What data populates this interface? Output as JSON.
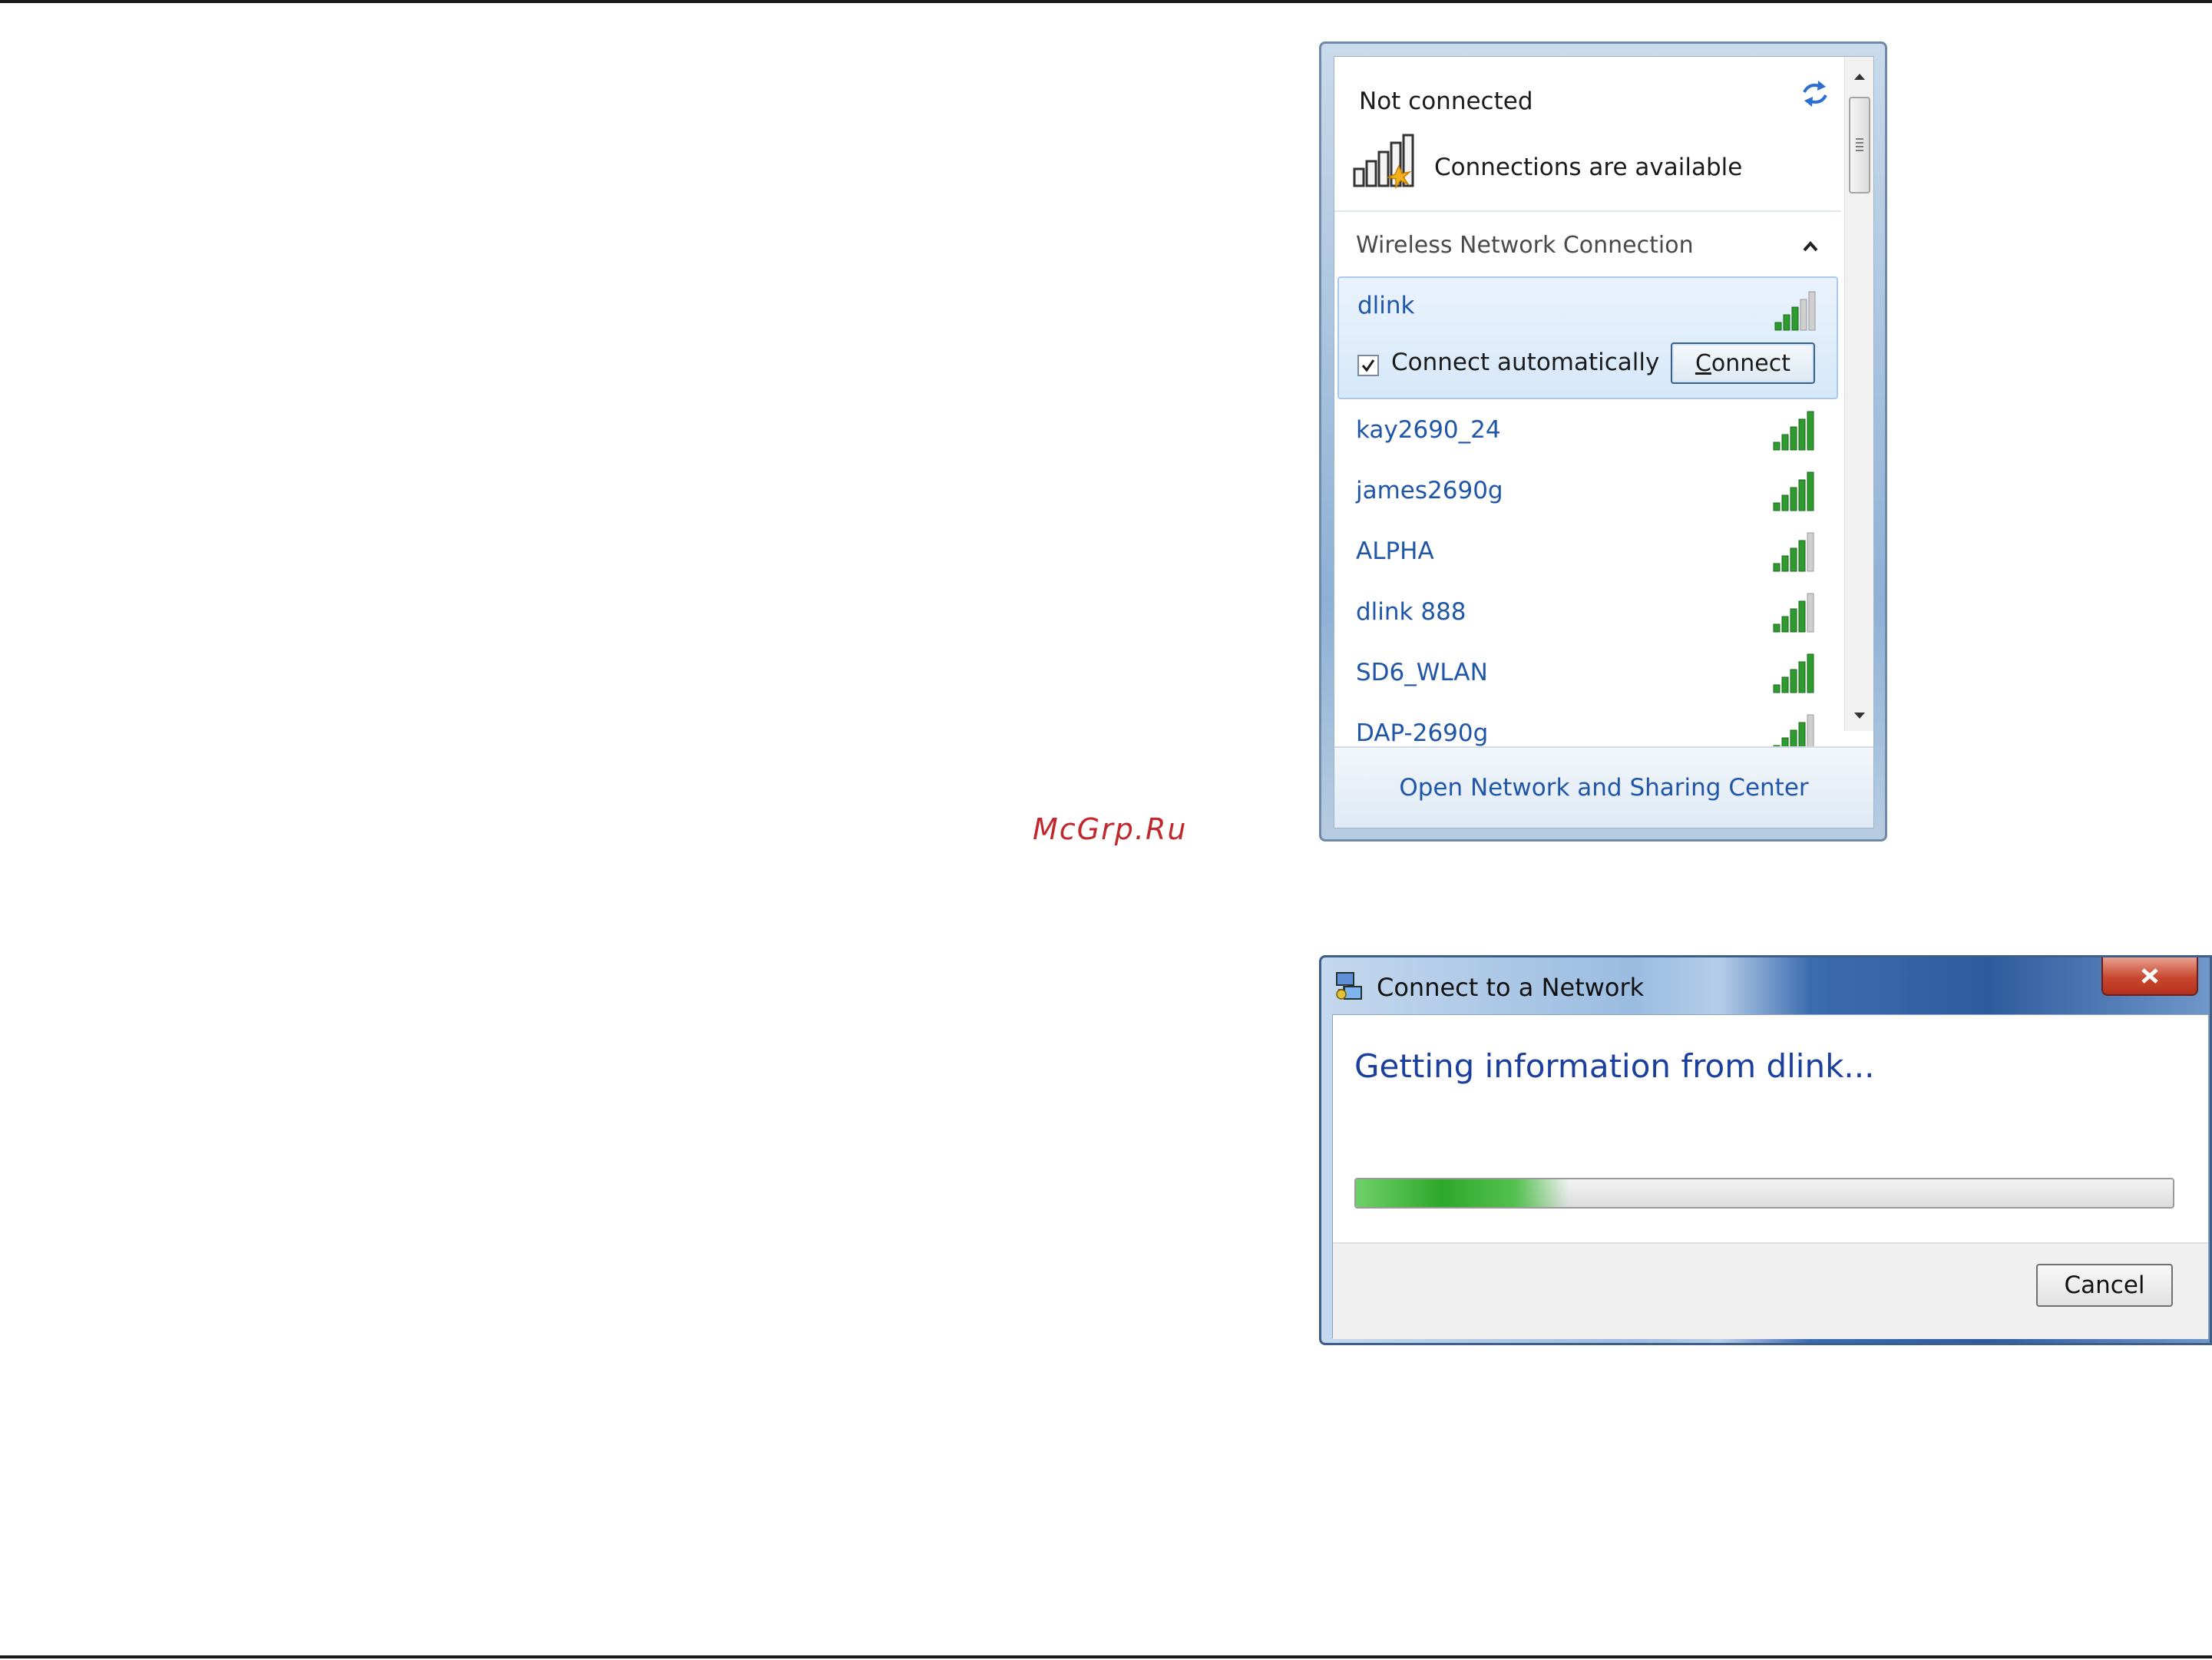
{
  "watermark": "McGrp.Ru",
  "flyout": {
    "status_title": "Not connected",
    "status_subtitle": "Connections are available",
    "section_label": "Wireless Network Connection",
    "selected_network": {
      "name": "dlink",
      "signal_bars": 3,
      "connect_automatically_label": "Connect automatically",
      "connect_automatically_checked": true,
      "connect_button_prefix": "",
      "connect_button_underlined": "C",
      "connect_button_rest": "onnect"
    },
    "networks": [
      {
        "name": "kay2690_24",
        "signal_bars": 5
      },
      {
        "name": "james2690g",
        "signal_bars": 5
      },
      {
        "name": "ALPHA",
        "signal_bars": 4
      },
      {
        "name": "dlink 888",
        "signal_bars": 4
      },
      {
        "name": "SD6_WLAN",
        "signal_bars": 5
      },
      {
        "name": "DAP-2690g",
        "signal_bars": 4
      }
    ],
    "footer_link": "Open Network and Sharing Center",
    "icons": [
      "refresh-icon",
      "signal-warning-icon",
      "collapse-arrow-icon",
      "scroll-up-icon",
      "scroll-down-icon"
    ]
  },
  "dialog": {
    "title": "Connect to a Network",
    "heading": "Getting information from dlink...",
    "progress_fraction": 0.26,
    "cancel_label": "Cancel",
    "icons": [
      "network-dialog-icon",
      "close-icon"
    ]
  },
  "colors": {
    "link_blue": "#1f56a8",
    "signal_green": "#2f9a2f",
    "heading_blue": "#1b3f9c",
    "close_red": "#c8472f"
  }
}
